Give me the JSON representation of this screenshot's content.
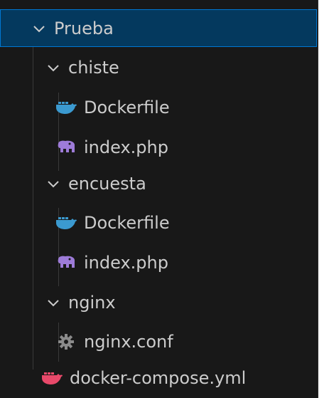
{
  "explorer": {
    "root": {
      "label": "Prueba",
      "icon": "chevron-down-icon"
    },
    "folders": [
      {
        "label": "chiste",
        "files": [
          {
            "label": "Dockerfile",
            "icon": "docker-icon",
            "color": "#3b9ad0"
          },
          {
            "label": "index.php",
            "icon": "php-elephant-icon",
            "color": "#9d7bd8"
          }
        ]
      },
      {
        "label": "encuesta",
        "files": [
          {
            "label": "Dockerfile",
            "icon": "docker-icon",
            "color": "#3b9ad0"
          },
          {
            "label": "index.php",
            "icon": "php-elephant-icon",
            "color": "#9d7bd8"
          }
        ]
      },
      {
        "label": "nginx",
        "files": [
          {
            "label": "nginx.conf",
            "icon": "gear-icon",
            "color": "#8a8a8a"
          }
        ]
      }
    ],
    "root_files": [
      {
        "label": "docker-compose.yml",
        "icon": "docker-compose-icon",
        "color": "#e8496a"
      }
    ]
  },
  "colors": {
    "background": "#181818",
    "selected_background": "#04395e",
    "focus_border": "#0078d4",
    "text": "#cccccc"
  }
}
